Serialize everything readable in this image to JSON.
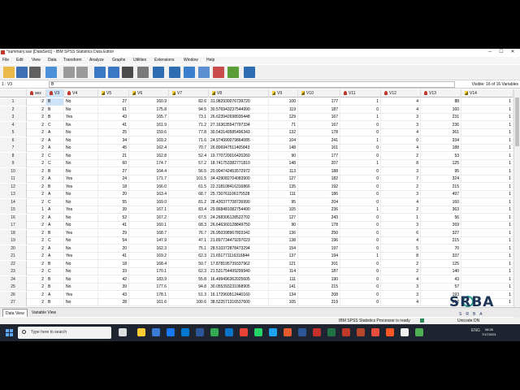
{
  "window": {
    "title": "*summary.sav [DataSet1] - IBM SPSS Statistics Data Editor",
    "controls": [
      "─",
      "☐",
      "✕"
    ]
  },
  "menu": [
    "File",
    "Edit",
    "View",
    "Data",
    "Transform",
    "Analyze",
    "Graphs",
    "Utilities",
    "Extensions",
    "Window",
    "Help"
  ],
  "toolbar_icons": [
    "open-icon",
    "save-icon",
    "print-icon",
    "dialog-recall-icon",
    "undo-icon",
    "redo-icon",
    "goto-case-icon",
    "goto-variable-icon",
    "variables-icon",
    "find-icon",
    "insert-cases-icon",
    "insert-variable-icon",
    "split-file-icon",
    "weight-cases-icon",
    "select-cases-icon",
    "value-labels-icon",
    "use-sets-icon",
    "spell-icon"
  ],
  "refbar": {
    "cell_ref": "1 : V3",
    "cell_value": "B",
    "visible": "Visible: 16 of 16 Variables"
  },
  "columns": [
    {
      "name": "sex",
      "type": "nominal"
    },
    {
      "name": "V3",
      "type": "nominal"
    },
    {
      "name": "V4",
      "type": "nominal"
    },
    {
      "name": "V5",
      "type": "scale"
    },
    {
      "name": "V6",
      "type": "scale"
    },
    {
      "name": "V7",
      "type": "scale"
    },
    {
      "name": "V8",
      "type": "scale"
    },
    {
      "name": "V9",
      "type": "scale"
    },
    {
      "name": "V10",
      "type": "scale"
    },
    {
      "name": "V11",
      "type": "nominal"
    },
    {
      "name": "V12",
      "type": "nominal"
    },
    {
      "name": "V13",
      "type": "nominal"
    },
    {
      "name": "V14",
      "type": "scale"
    }
  ],
  "rows": [
    [
      "1",
      "2",
      "B",
      "No",
      "27",
      "160.9",
      "82.6",
      "31.982930076739720",
      "100",
      "177",
      "1",
      "4",
      "88",
      "1"
    ],
    [
      "2",
      "2",
      "B",
      "No",
      "61",
      "175.8",
      "94.5",
      "30.576943237544990",
      "119",
      "187",
      "0",
      "4",
      "160",
      "1"
    ],
    [
      "3",
      "2",
      "B",
      "Yes",
      "43",
      "165.7",
      "73.1",
      "26.623942698935448",
      "129",
      "167",
      "1",
      "3",
      "231",
      "1"
    ],
    [
      "4",
      "2",
      "C",
      "No",
      "41",
      "161.9",
      "71.2",
      "27.163635547797334",
      "71",
      "167",
      "0",
      "3",
      "236",
      "1"
    ],
    [
      "5",
      "2",
      "A",
      "No",
      "25",
      "159.6",
      "77.8",
      "30.543149585496343",
      "132",
      "178",
      "0",
      "4",
      "361",
      "1"
    ],
    [
      "6",
      "2",
      "A",
      "No",
      "34",
      "169.2",
      "71.6",
      "24.974990079864085",
      "104",
      "241",
      "1",
      "0",
      "334",
      "1"
    ],
    [
      "7",
      "2",
      "A",
      "No",
      "45",
      "162.4",
      "70.7",
      "26.806947511465843",
      "148",
      "161",
      "0",
      "4",
      "188",
      "1"
    ],
    [
      "8",
      "2",
      "C",
      "No",
      "21",
      "162.8",
      "52.4",
      "19.770720016420260",
      "90",
      "177",
      "0",
      "2",
      "53",
      "1"
    ],
    [
      "9",
      "2",
      "C",
      "No",
      "60",
      "174.7",
      "57.2",
      "18.741753382771810",
      "148",
      "207",
      "1",
      "8",
      "125",
      "1"
    ],
    [
      "10",
      "2",
      "B",
      "No",
      "27",
      "164.4",
      "56.5",
      "20.904742453572972",
      "113",
      "188",
      "0",
      "3",
      "95",
      "1"
    ],
    [
      "11",
      "2",
      "A",
      "Yes",
      "24",
      "171.7",
      "101.5",
      "34.429082704083900",
      "127",
      "182",
      "0",
      "7",
      "324",
      "1"
    ],
    [
      "12",
      "2",
      "B",
      "Yes",
      "18",
      "166.0",
      "61.5",
      "22.318108416316866",
      "135",
      "192",
      "0",
      "2",
      "215",
      "1"
    ],
    [
      "13",
      "2",
      "A",
      "No",
      "20",
      "163.4",
      "68.7",
      "25.730761106175528",
      "111",
      "186",
      "0",
      "3",
      "497",
      "1"
    ],
    [
      "14",
      "2",
      "C",
      "No",
      "55",
      "169.0",
      "81.2",
      "28.430377708736990",
      "95",
      "204",
      "0",
      "4",
      "160",
      "1"
    ],
    [
      "15",
      "1",
      "A",
      "Yes",
      "39",
      "167.1",
      "83.4",
      "29.868481082754490",
      "105",
      "236",
      "1",
      "2",
      "363",
      "1"
    ],
    [
      "16",
      "2",
      "A",
      "No",
      "52",
      "167.2",
      "67.5",
      "24.268306128522702",
      "127",
      "243",
      "0",
      "1",
      "56",
      "1"
    ],
    [
      "17",
      "2",
      "A",
      "No",
      "41",
      "160.1",
      "68.3",
      "26.646360128849750",
      "90",
      "178",
      "0",
      "3",
      "269",
      "1"
    ],
    [
      "18",
      "2",
      "B",
      "Yes",
      "29",
      "168.7",
      "76.7",
      "26.950398967803342",
      "136",
      "250",
      "0",
      "6",
      "327",
      "1"
    ],
    [
      "19",
      "2",
      "C",
      "No",
      "54",
      "147.9",
      "47.1",
      "21.897734479297023",
      "138",
      "196",
      "0",
      "4",
      "215",
      "1"
    ],
    [
      "20",
      "2",
      "A",
      "No",
      "20",
      "162.3",
      "75.1",
      "28.510372878473294",
      "154",
      "197",
      "0",
      "5",
      "70",
      "1"
    ],
    [
      "21",
      "2",
      "A",
      "Yes",
      "41",
      "169.2",
      "62.3",
      "21.651771116316844",
      "137",
      "194",
      "1",
      "8",
      "337",
      "1"
    ],
    [
      "22",
      "2",
      "B",
      "No",
      "18",
      "168.4",
      "50.7",
      "17.878195739337962",
      "121",
      "201",
      "0",
      "2",
      "125",
      "1"
    ],
    [
      "23",
      "2",
      "C",
      "No",
      "33",
      "170.1",
      "62.3",
      "21.531754499299940",
      "114",
      "187",
      "0",
      "2",
      "140",
      "1"
    ],
    [
      "24",
      "2",
      "B",
      "No",
      "42",
      "183.9",
      "55.8",
      "16.499496362025605",
      "111",
      "190",
      "0",
      "4",
      "43",
      "1"
    ],
    [
      "25",
      "2",
      "B",
      "No",
      "39",
      "177.6",
      "94.8",
      "30.055393231068905",
      "141",
      "215",
      "0",
      "3",
      "57",
      "1"
    ],
    [
      "26",
      "2",
      "A",
      "Yes",
      "43",
      "178.1",
      "51.3",
      "16.172960512440160",
      "134",
      "208",
      "0",
      "3",
      "193",
      "1"
    ],
    [
      "27",
      "2",
      "B",
      "No",
      "28",
      "161.6",
      "100.6",
      "38.522571316537600",
      "105",
      "219",
      "0",
      "4",
      "212",
      "1"
    ]
  ],
  "tabs": [
    "Data View",
    "Variable View"
  ],
  "status": {
    "text": "IBM SPSS Statistics Processor is ready",
    "encoding": "Unicode:ON"
  },
  "watermark": {
    "brand": "SRBA",
    "sub": "SRBA"
  },
  "taskbar": {
    "search_placeholder": "Type here to search",
    "tray_lang": "ENG",
    "time": "08:26",
    "date": "7/17/2021"
  },
  "colors": {
    "selection": "#cfe3f8",
    "taskbar": "#1f2530",
    "brand": "#1d3557"
  }
}
